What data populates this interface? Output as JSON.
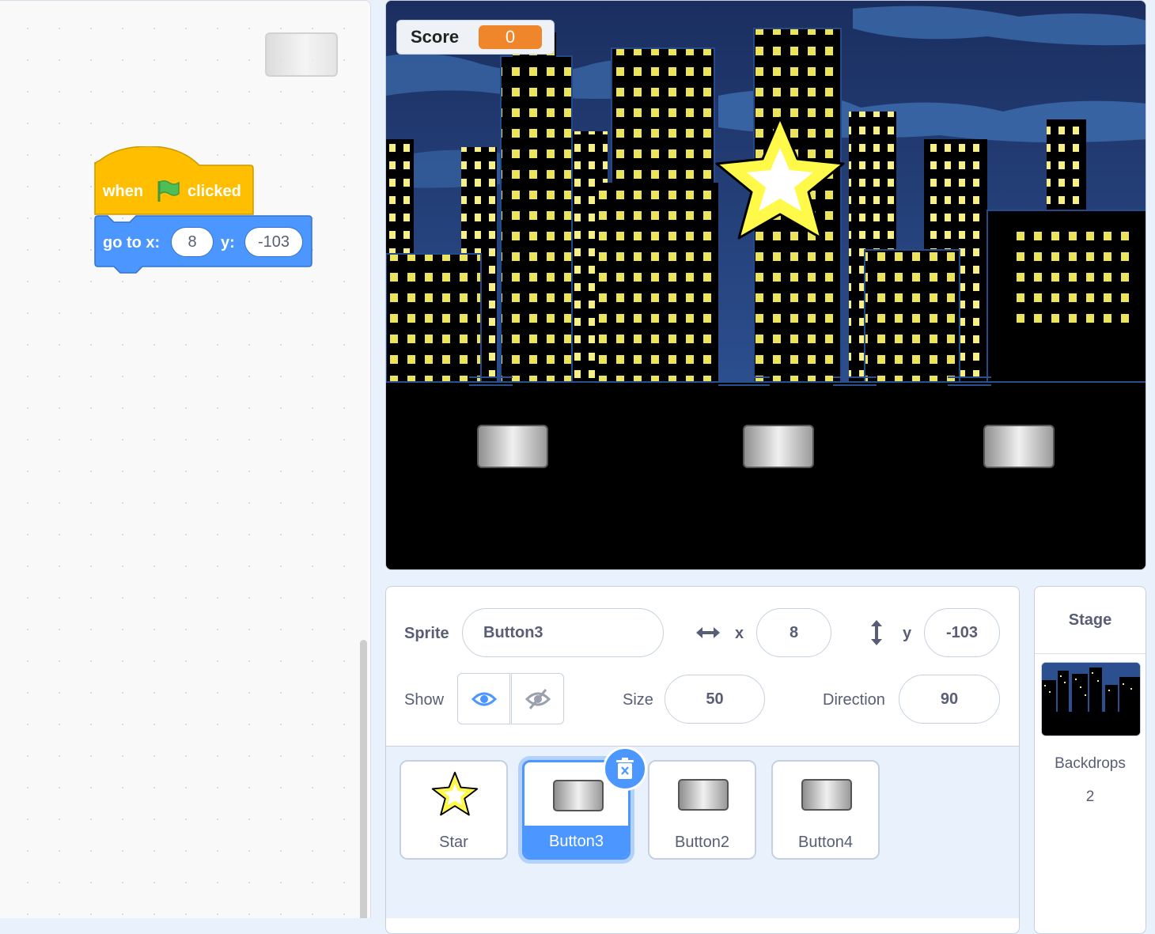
{
  "code": {
    "hat_block": {
      "prefix": "when",
      "suffix": "clicked",
      "icon": "green-flag-icon"
    },
    "motion_block": {
      "label_x": "go to x:",
      "x_value": "8",
      "label_y": "y:",
      "y_value": "-103"
    }
  },
  "stage": {
    "score_monitor": {
      "label": "Score",
      "value": "0",
      "color": "#f0862b"
    }
  },
  "sprite_info": {
    "sprite_label": "Sprite",
    "sprite_name": "Button3",
    "x_label": "x",
    "x_value": "8",
    "y_label": "y",
    "y_value": "-103",
    "show_label": "Show",
    "size_label": "Size",
    "size_value": "50",
    "direction_label": "Direction",
    "direction_value": "90"
  },
  "sprites": [
    {
      "name": "Star",
      "icon": "star-icon",
      "selected": false
    },
    {
      "name": "Button3",
      "icon": "button-icon",
      "selected": true
    },
    {
      "name": "Button2",
      "icon": "button-icon",
      "selected": false
    },
    {
      "name": "Button4",
      "icon": "button-icon",
      "selected": false
    }
  ],
  "stage_panel": {
    "title": "Stage",
    "backdrops_label": "Backdrops",
    "backdrops_count": "2"
  },
  "colors": {
    "accent": "#4c97ff",
    "events": "#ffbf00",
    "motion": "#4c97ff"
  }
}
